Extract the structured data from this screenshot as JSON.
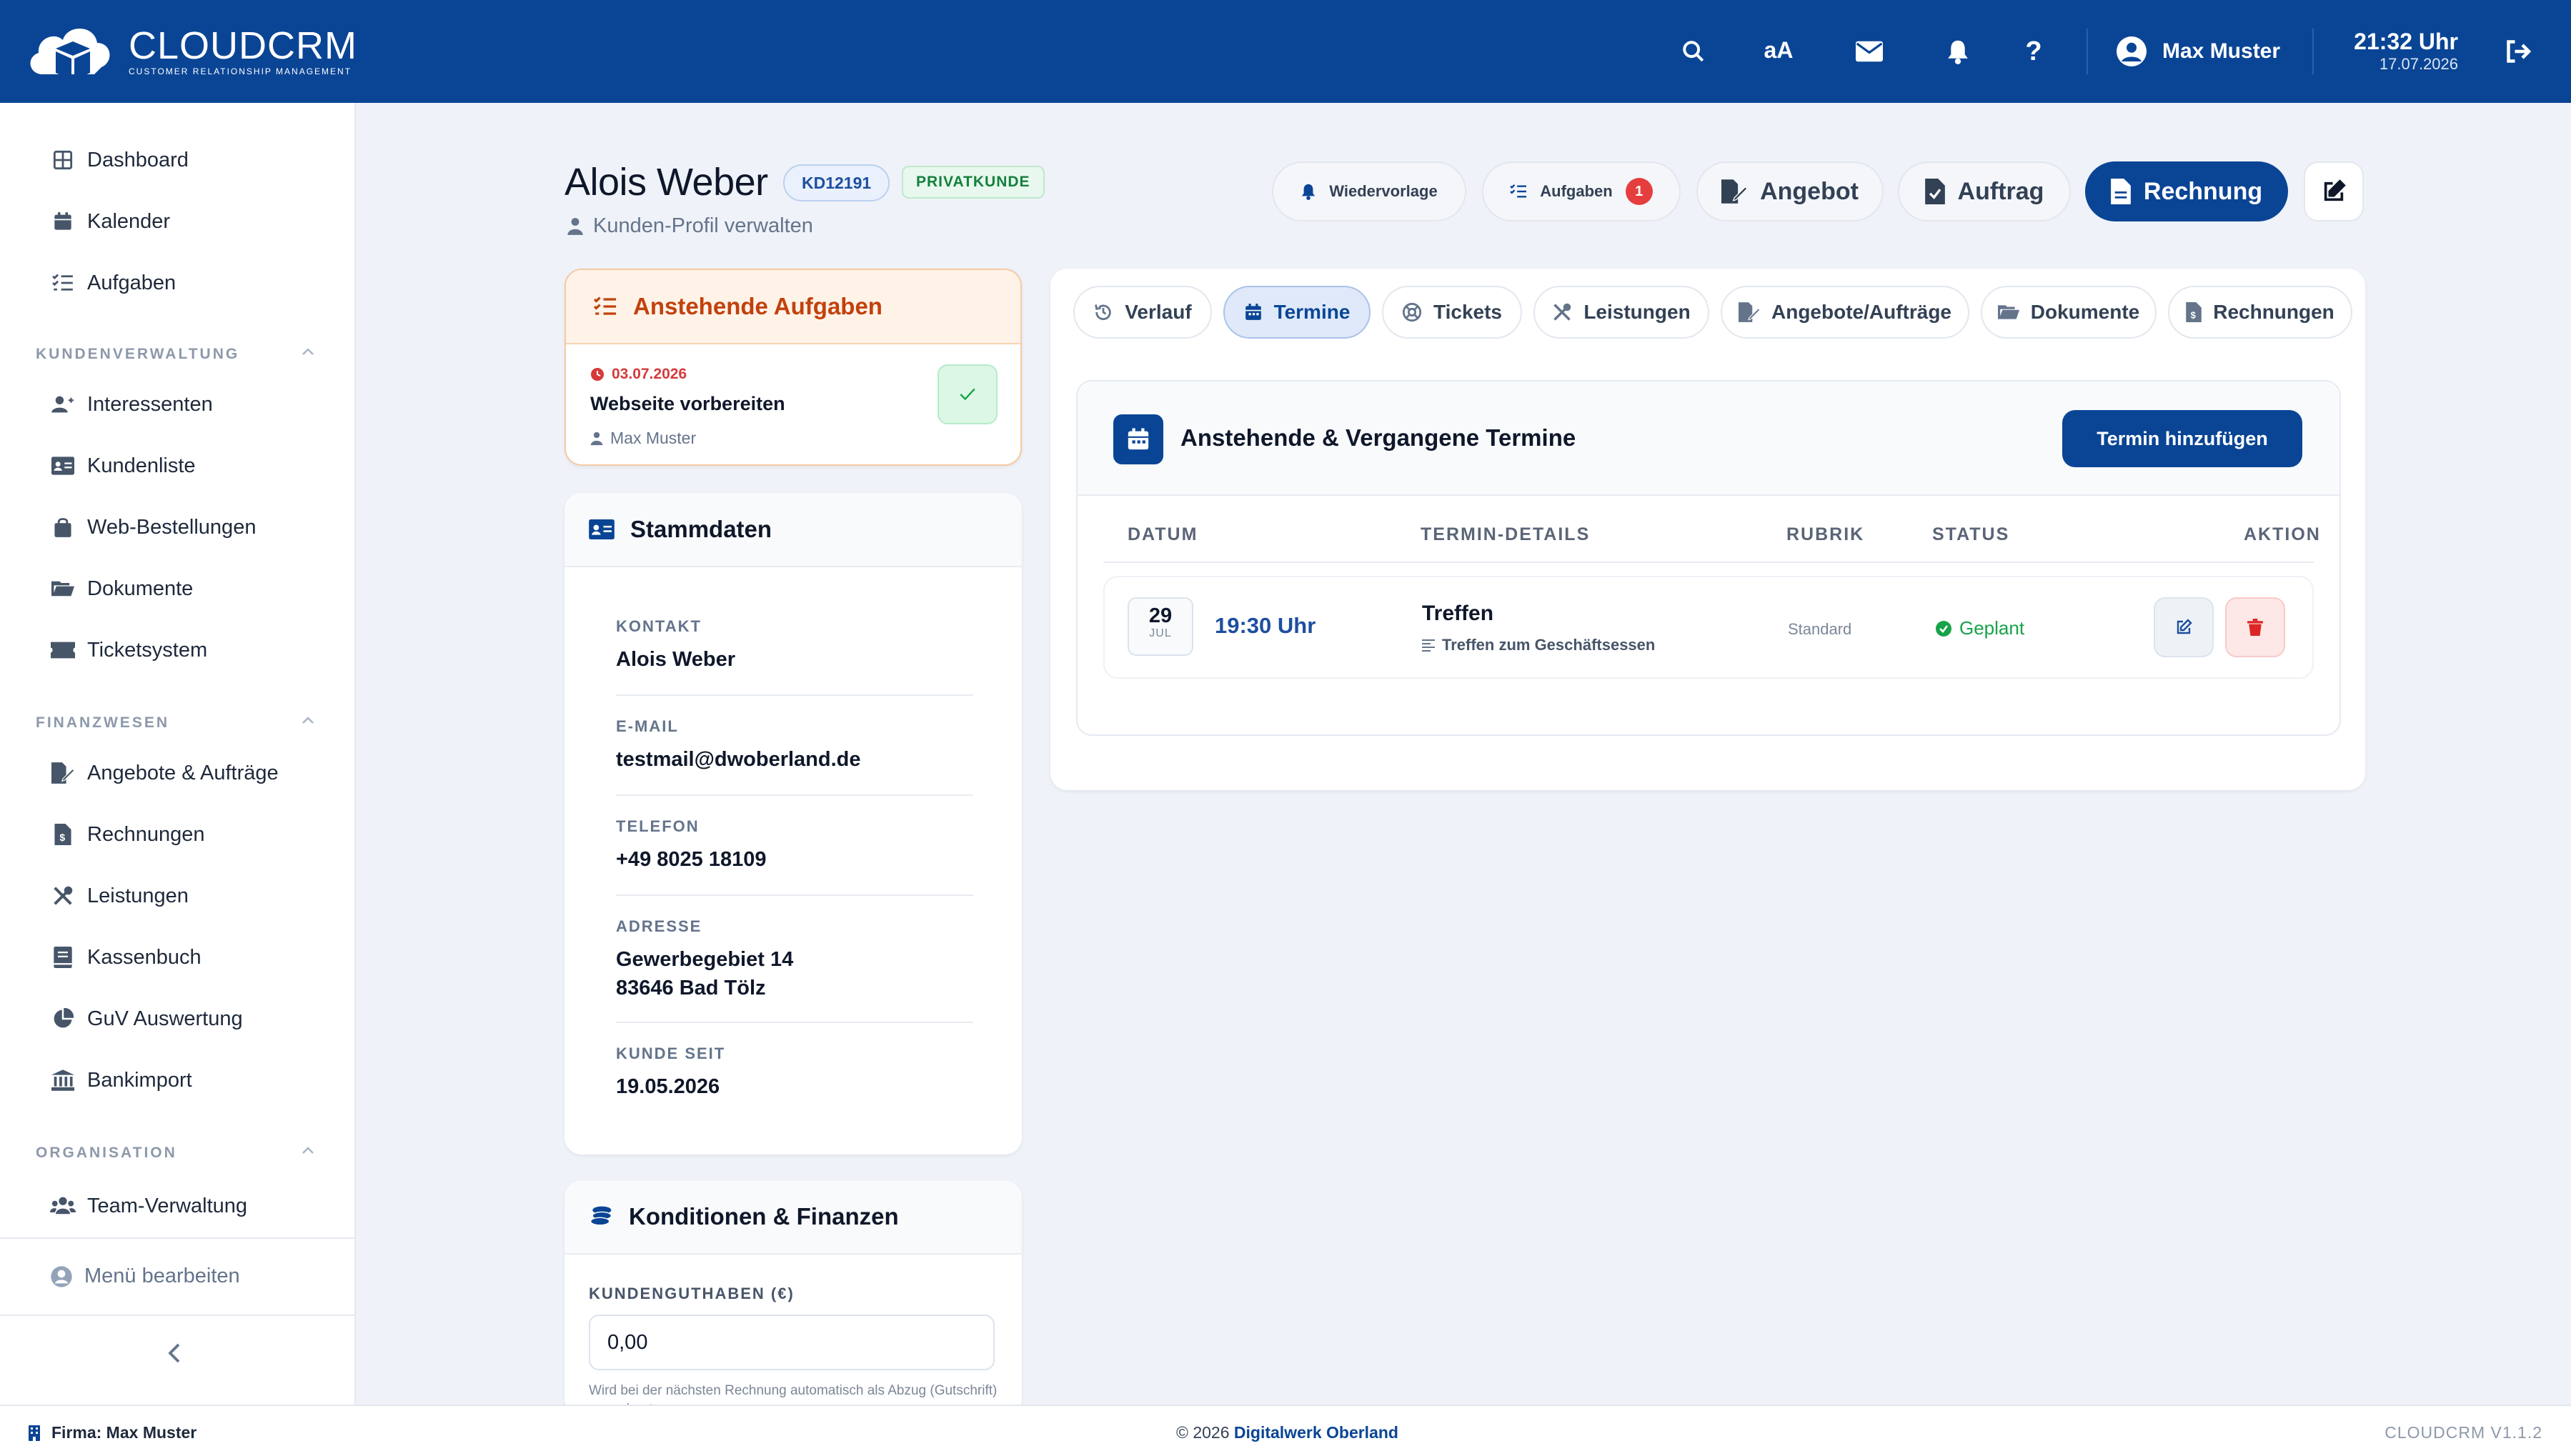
{
  "app": {
    "logo_title": "CLOUDCRM",
    "logo_subtitle": "CUSTOMER RELATIONSHIP MANAGEMENT",
    "accent_color": "#0a4595"
  },
  "topbar": {
    "font_toggle": "aA",
    "user_name": "Max Muster",
    "time": "21:32 Uhr",
    "date": "17.07.2026"
  },
  "sidebar": {
    "top_items": [
      {
        "label": "Dashboard",
        "icon": "grid-icon"
      },
      {
        "label": "Kalender",
        "icon": "calendar-icon"
      },
      {
        "label": "Aufgaben",
        "icon": "list-check-icon"
      }
    ],
    "sections": [
      {
        "title": "KUNDENVERWALTUNG",
        "items": [
          {
            "label": "Interessenten",
            "icon": "user-plus-icon"
          },
          {
            "label": "Kundenliste",
            "icon": "id-card-icon"
          },
          {
            "label": "Web-Bestellungen",
            "icon": "shopping-bag-icon"
          },
          {
            "label": "Dokumente",
            "icon": "folder-icon"
          },
          {
            "label": "Ticketsystem",
            "icon": "ticket-icon"
          }
        ]
      },
      {
        "title": "FINANZWESEN",
        "items": [
          {
            "label": "Angebote & Aufträge",
            "icon": "file-signature-icon"
          },
          {
            "label": "Rechnungen",
            "icon": "invoice-icon"
          },
          {
            "label": "Leistungen",
            "icon": "tools-icon"
          },
          {
            "label": "Kassenbuch",
            "icon": "book-icon"
          },
          {
            "label": "GuV Auswertung",
            "icon": "pie-chart-icon"
          },
          {
            "label": "Bankimport",
            "icon": "bank-icon"
          }
        ]
      },
      {
        "title": "ORGANISATION",
        "items": [
          {
            "label": "Team-Verwaltung",
            "icon": "users-icon"
          }
        ]
      }
    ],
    "menu_edit": "Menü bearbeiten"
  },
  "customer": {
    "name": "Alois Weber",
    "id_badge": "KD12191",
    "type_badge": "PRIVATKUNDE",
    "subtitle": "Kunden-Profil verwalten"
  },
  "header_buttons": {
    "wiedervorlage": "Wiedervorlage",
    "aufgaben": "Aufgaben",
    "aufgaben_count": "1",
    "angebot": "Angebot",
    "auftrag": "Auftrag",
    "rechnung": "Rechnung"
  },
  "tasks_card": {
    "title": "Anstehende Aufgaben",
    "task": {
      "date": "03.07.2026",
      "title": "Webseite vorbereiten",
      "user": "Max Muster"
    }
  },
  "stammdaten": {
    "title": "Stammdaten",
    "fields": [
      {
        "label": "KONTAKT",
        "value": "Alois Weber"
      },
      {
        "label": "E-MAIL",
        "value": "testmail@dwoberland.de"
      },
      {
        "label": "TELEFON",
        "value": "+49 8025 18109"
      },
      {
        "label": "ADRESSE",
        "value_line1": "Gewerbegebiet 14",
        "value_line2": "83646 Bad Tölz"
      },
      {
        "label": "KUNDE SEIT",
        "value": "19.05.2026"
      }
    ]
  },
  "konditionen": {
    "title": "Konditionen & Finanzen",
    "guthaben_label": "KUNDENGUTHABEN (€)",
    "guthaben_value": "0,00",
    "hint": "Wird bei der nächsten Rechnung automatisch als Abzug (Gutschrift) verrechnet."
  },
  "tabs": [
    {
      "label": "Verlauf",
      "icon": "history-icon"
    },
    {
      "label": "Termine",
      "icon": "calendar-icon",
      "active": true
    },
    {
      "label": "Tickets",
      "icon": "lifebuoy-icon"
    },
    {
      "label": "Leistungen",
      "icon": "tools-icon"
    },
    {
      "label": "Angebote/Aufträge",
      "icon": "file-signature-icon"
    },
    {
      "label": "Dokumente",
      "icon": "folder-icon"
    },
    {
      "label": "Rechnungen",
      "icon": "invoice-icon"
    }
  ],
  "termine": {
    "title": "Anstehende & Vergangene Termine",
    "add_button": "Termin hinzufügen",
    "columns": [
      "DATUM",
      "TERMIN-DETAILS",
      "RUBRIK",
      "STATUS",
      "AKTION"
    ],
    "rows": [
      {
        "day": "29",
        "month": "JUL",
        "time": "19:30 Uhr",
        "title": "Treffen",
        "description": "Treffen zum Geschäftsessen",
        "rubrik": "Standard",
        "status": "Geplant",
        "status_color": "#16a34a"
      }
    ]
  },
  "footer": {
    "company": "Firma: Max Muster",
    "copyright": "© 2026",
    "copyright_link": "Digitalwerk Oberland",
    "version": "CLOUDCRM V1.1.2"
  }
}
